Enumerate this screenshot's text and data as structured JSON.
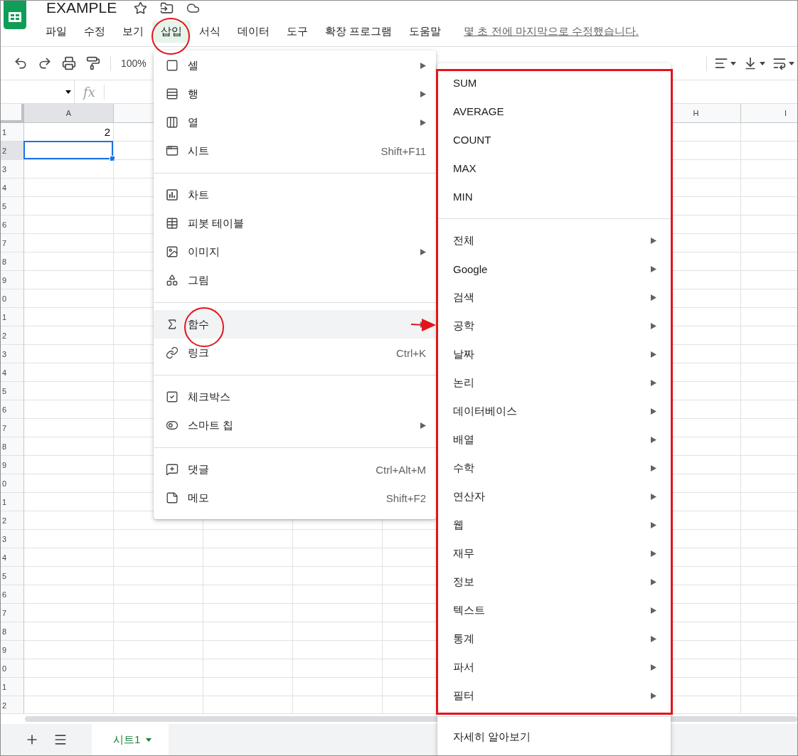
{
  "document": {
    "title": "EXAMPLE"
  },
  "menu_bar": {
    "items": [
      {
        "label": "파일",
        "selected": false
      },
      {
        "label": "수정",
        "selected": false
      },
      {
        "label": "보기",
        "selected": false
      },
      {
        "label": "삽입",
        "selected": true
      },
      {
        "label": "서식",
        "selected": false
      },
      {
        "label": "데이터",
        "selected": false
      },
      {
        "label": "도구",
        "selected": false
      },
      {
        "label": "확장 프로그램",
        "selected": false
      },
      {
        "label": "도움말",
        "selected": false
      }
    ],
    "last_edit": "몇 초 전에 마지막으로 수정했습니다."
  },
  "toolbar": {
    "zoom": "100%"
  },
  "formula_bar": {
    "fx_label": "fx"
  },
  "grid": {
    "columns": [
      {
        "label": "A",
        "selected": true
      },
      {
        "selected": false
      },
      {},
      {},
      {},
      {},
      {},
      {
        "label": "H",
        "selected": false
      },
      {
        "label": "I",
        "selected": false
      }
    ],
    "rows": [
      {
        "label": "1",
        "selected": false,
        "cells": [
          "2"
        ]
      },
      {
        "label": "2",
        "selected": true
      },
      {
        "label": "3",
        "selected": false
      },
      {
        "label": "4",
        "selected": false
      },
      {
        "label": "5",
        "selected": false
      },
      {
        "label": "6",
        "selected": false
      },
      {
        "label": "7",
        "selected": false
      },
      {
        "label": "8",
        "selected": false
      },
      {
        "label": "9",
        "selected": false
      },
      {
        "label": "0",
        "selected": false
      },
      {
        "label": "1",
        "selected": false
      },
      {
        "label": "2",
        "selected": false
      },
      {
        "label": "3",
        "selected": false
      },
      {
        "label": "4",
        "selected": false
      },
      {
        "label": "5",
        "selected": false
      },
      {
        "label": "6",
        "selected": false
      },
      {
        "label": "7",
        "selected": false
      },
      {
        "label": "8",
        "selected": false
      },
      {
        "label": "9",
        "selected": false
      },
      {
        "label": "0",
        "selected": false
      },
      {
        "label": "1",
        "selected": false
      },
      {
        "label": "2",
        "selected": false
      },
      {
        "label": "3",
        "selected": false
      },
      {
        "label": "4",
        "selected": false
      },
      {
        "label": "5",
        "selected": false
      },
      {
        "label": "6",
        "selected": false
      },
      {
        "label": "7",
        "selected": false
      },
      {
        "label": "8",
        "selected": false
      },
      {
        "label": "9",
        "selected": false
      },
      {
        "label": "0",
        "selected": false
      },
      {
        "label": "1",
        "selected": false
      },
      {
        "label": "2",
        "selected": false
      }
    ]
  },
  "insert_menu": {
    "groups": [
      {
        "items": [
          {
            "label": "셀",
            "has_submenu": true,
            "selected": false
          },
          {
            "label": "행",
            "has_submenu": true,
            "selected": false
          },
          {
            "label": "열",
            "has_submenu": true,
            "selected": false
          },
          {
            "label": "시트",
            "shortcut": "Shift+F11",
            "has_submenu": false,
            "selected": false
          }
        ]
      },
      {
        "items": [
          {
            "label": "차트",
            "has_submenu": false,
            "selected": false
          },
          {
            "label": "피봇 테이블",
            "has_submenu": false,
            "selected": false
          },
          {
            "label": "이미지",
            "has_submenu": true,
            "selected": false
          },
          {
            "label": "그림",
            "has_submenu": false,
            "selected": false
          }
        ]
      },
      {
        "items": [
          {
            "label": "함수",
            "has_submenu": true,
            "selected": true
          },
          {
            "label": "링크",
            "shortcut": "Ctrl+K",
            "has_submenu": false,
            "selected": false
          }
        ]
      },
      {
        "items": [
          {
            "label": "체크박스",
            "has_submenu": false,
            "selected": false
          },
          {
            "label": "스마트 칩",
            "has_submenu": true,
            "selected": false
          }
        ]
      },
      {
        "items": [
          {
            "label": "댓글",
            "shortcut": "Ctrl+Alt+M",
            "has_submenu": false,
            "selected": false
          },
          {
            "label": "메모",
            "shortcut": "Shift+F2",
            "has_submenu": false,
            "selected": false
          }
        ]
      }
    ]
  },
  "functions_submenu": {
    "groups": [
      {
        "items": [
          {
            "label": "SUM",
            "has_submenu": false
          },
          {
            "label": "AVERAGE",
            "has_submenu": false
          },
          {
            "label": "COUNT",
            "has_submenu": false
          },
          {
            "label": "MAX",
            "has_submenu": false
          },
          {
            "label": "MIN",
            "has_submenu": false
          }
        ]
      },
      {
        "items": [
          {
            "label": "전체",
            "has_submenu": true
          },
          {
            "label": "Google",
            "has_submenu": true
          },
          {
            "label": "검색",
            "has_submenu": true
          },
          {
            "label": "공학",
            "has_submenu": true
          },
          {
            "label": "날짜",
            "has_submenu": true
          },
          {
            "label": "논리",
            "has_submenu": true
          },
          {
            "label": "데이터베이스",
            "has_submenu": true
          },
          {
            "label": "배열",
            "has_submenu": true
          },
          {
            "label": "수학",
            "has_submenu": true
          },
          {
            "label": "연산자",
            "has_submenu": true
          },
          {
            "label": "웹",
            "has_submenu": true
          },
          {
            "label": "재무",
            "has_submenu": true
          },
          {
            "label": "정보",
            "has_submenu": true
          },
          {
            "label": "텍스트",
            "has_submenu": true
          },
          {
            "label": "통계",
            "has_submenu": true
          },
          {
            "label": "파서",
            "has_submenu": true
          },
          {
            "label": "필터",
            "has_submenu": true
          }
        ]
      },
      {
        "items": [
          {
            "label": "자세히 알아보기",
            "has_submenu": false
          }
        ]
      }
    ]
  },
  "sheet_tabs": [
    {
      "label": "시트1",
      "selected": true
    }
  ]
}
